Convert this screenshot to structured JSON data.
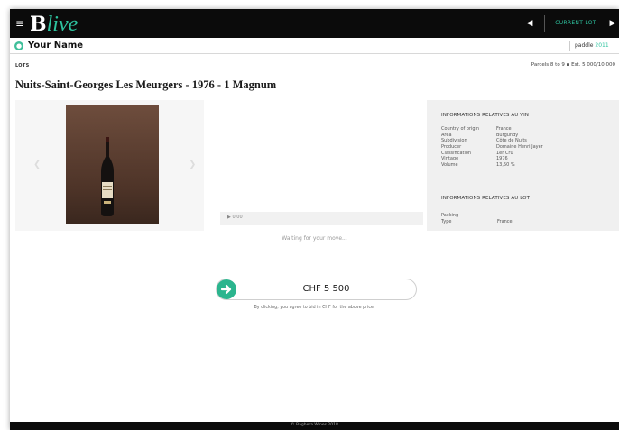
{
  "header": {
    "menu_icon": "hamburger-icon",
    "logo_b": "B",
    "logo_live": "live",
    "current_lot_label": "CURRENT LOT",
    "prev_icon": "caret-left-icon",
    "next_icon": "caret-right-icon",
    "accent_color": "#2ec4a0"
  },
  "user": {
    "name": "Your Name",
    "paddle_label": "paddle",
    "paddle_number": "2011"
  },
  "lot": {
    "section_label": "LOTS",
    "info": "Parcels 8 to 9 ▪ Est. 5 000/10 000",
    "title": "Nuits-Saint-Georges Les Meurgers - 1976 - 1 Magnum"
  },
  "video": {
    "time": "0:00"
  },
  "status": {
    "waiting": "Waiting for your move..."
  },
  "wine_info": {
    "heading": "INFORMATIONS RELATIVES AU VIN",
    "rows": [
      {
        "key": "Country of origin",
        "value": "France"
      },
      {
        "key": "Area",
        "value": "Burgundy"
      },
      {
        "key": "Subdivision",
        "value": "Côte de Nuits"
      },
      {
        "key": "Producer",
        "value": "Domaine Henri Jayer"
      },
      {
        "key": "Classification",
        "value": "1er Cru"
      },
      {
        "key": "Vintage",
        "value": "1976"
      },
      {
        "key": "Volume",
        "value": "13,50 %"
      }
    ]
  },
  "lot_info": {
    "heading": "INFORMATIONS RELATIVES AU LOT",
    "rows": [
      {
        "key": "Packing",
        "value": ""
      },
      {
        "key": "Type",
        "value": "France"
      }
    ]
  },
  "bid": {
    "amount": "CHF 5 500",
    "note": "By clicking, you agree to bid in CHF for the above price.",
    "button_color": "#2bb58e"
  },
  "footer": {
    "text": "© Baghera Wines 2018"
  }
}
